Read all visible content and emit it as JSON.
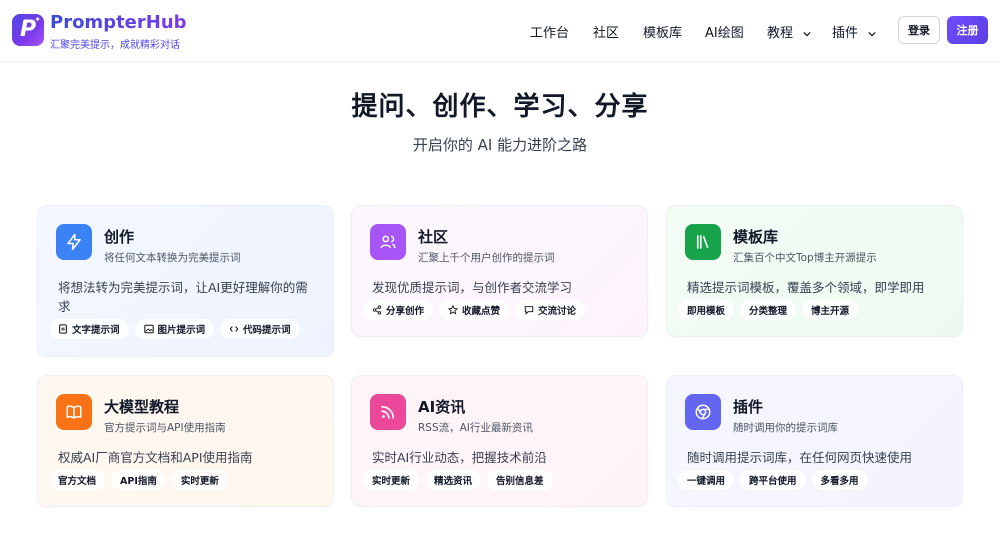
{
  "brand": {
    "name": "PrompterHub",
    "tagline": "汇聚完美提示，成就精彩对话",
    "logo_letter": "P"
  },
  "nav": {
    "items": [
      {
        "label": "工作台",
        "dropdown": false
      },
      {
        "label": "社区",
        "dropdown": false
      },
      {
        "label": "模板库",
        "dropdown": false
      },
      {
        "label": "AI绘图",
        "dropdown": false
      },
      {
        "label": "教程",
        "dropdown": true
      },
      {
        "label": "插件",
        "dropdown": true
      }
    ],
    "login_label": "登录",
    "signup_label": "注册"
  },
  "hero": {
    "title": "提问、创作、学习、分享",
    "subtitle": "开启你的 AI 能力进阶之路"
  },
  "cards": [
    {
      "title": "创作",
      "subtitle": "将任何文本转换为完美提示词",
      "desc": "将想法转为完美提示词，让AI更好理解你的需求",
      "icon": "lightning-icon",
      "tags": [
        {
          "label": "文字提示词",
          "icon": "document-icon"
        },
        {
          "label": "图片提示词",
          "icon": "image-icon"
        },
        {
          "label": "代码提示词",
          "icon": "code-icon"
        }
      ]
    },
    {
      "title": "社区",
      "subtitle": "汇聚上千个用户创作的提示词",
      "desc": "发现优质提示词，与创作者交流学习",
      "icon": "users-icon",
      "tags": [
        {
          "label": "分享创作",
          "icon": "share-icon"
        },
        {
          "label": "收藏点赞",
          "icon": "star-icon"
        },
        {
          "label": "交流讨论",
          "icon": "chat-icon"
        }
      ]
    },
    {
      "title": "模板库",
      "subtitle": "汇集百个中文Top博主开源提示",
      "desc": "精选提示词模板，覆盖多个领域，即学即用",
      "icon": "library-icon",
      "tags": [
        {
          "label": "即用模板"
        },
        {
          "label": "分类整理"
        },
        {
          "label": "博主开源"
        }
      ]
    },
    {
      "title": "大模型教程",
      "subtitle": "官方提示词与API使用指南",
      "desc": "权威AI厂商官方文档和API使用指南",
      "icon": "book-icon",
      "tags": [
        {
          "label": "官方文档"
        },
        {
          "label": "API指南"
        },
        {
          "label": "实时更新"
        }
      ]
    },
    {
      "title": "AI资讯",
      "subtitle": "RSS流，AI行业最新资讯",
      "desc": "实时AI行业动态，把握技术前沿",
      "icon": "rss-icon",
      "tags": [
        {
          "label": "实时更新"
        },
        {
          "label": "精选资讯"
        },
        {
          "label": "告别信息差"
        }
      ]
    },
    {
      "title": "插件",
      "subtitle": "随时调用你的提示词库",
      "desc": "随时调用提示词库，在任何网页快速使用",
      "icon": "chrome-icon",
      "tags": [
        {
          "label": "一键调用"
        },
        {
          "label": "跨平台使用"
        },
        {
          "label": "多看多用"
        }
      ]
    }
  ],
  "colors": {
    "brand": "#5b3fe0",
    "create": "#3b82f6",
    "community": "#a855f7",
    "templates": "#16a34a",
    "tutorial": "#f97316",
    "news": "#ec4899",
    "plugin": "#6366f1"
  }
}
